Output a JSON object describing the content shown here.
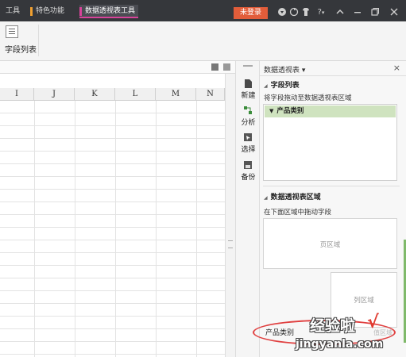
{
  "titlebar": {
    "tabs": [
      {
        "label": "工具",
        "color": "#4a90d9",
        "active": false
      },
      {
        "label": "特色功能",
        "color": "#f0a030",
        "active": false
      },
      {
        "label": "数据透视表工具",
        "color": "#d8439a",
        "active": true
      }
    ],
    "login_label": "未登录",
    "icons": [
      "skin-icon",
      "sync-icon",
      "shirt-icon",
      "help-icon",
      "collapse-icon",
      "minimize-icon",
      "restore-icon",
      "close-icon"
    ],
    "help_glyph": "?",
    "caret_glyph": "⌃",
    "minimize_glyph": "—",
    "restore_glyph": "❐",
    "close_glyph": "✕"
  },
  "ribbon": {
    "field_list_label": "字段列表"
  },
  "sheet": {
    "columns": [
      "I",
      "J",
      "K",
      "L",
      "M",
      "N"
    ]
  },
  "strip": {
    "buttons": [
      {
        "label": "新建",
        "icon": "new-doc-icon"
      },
      {
        "label": "分析",
        "icon": "analysis-icon"
      },
      {
        "label": "选择",
        "icon": "select-icon"
      },
      {
        "label": "备份",
        "icon": "backup-icon"
      }
    ]
  },
  "pane": {
    "title": "数据透视表 ▾",
    "close_glyph": "×",
    "field_section_title": "字段列表",
    "field_hint": "将字段拖动至数据透视表区域",
    "fields": [
      "产品类别"
    ],
    "area_section_title": "数据透视表区域",
    "area_hint": "在下面区域中拖动字段",
    "page_area": "页区域",
    "column_area": "列区域",
    "row_field": "产品类别"
  },
  "watermark": {
    "line1": "经验啦",
    "check": "√",
    "line2": "jingyanla.com",
    "faint": "值区域"
  },
  "colors": {
    "titlebar_bg": "#35373b",
    "accent_pink": "#d8439a",
    "login_orange": "#e25d3a",
    "field_green": "#cfe3bf",
    "oval_red": "#e04040"
  }
}
